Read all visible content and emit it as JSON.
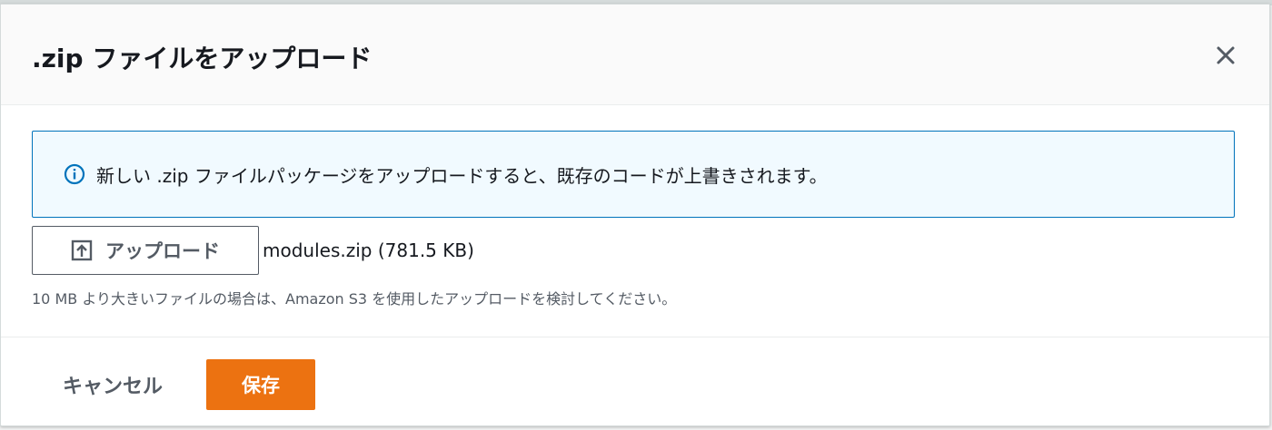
{
  "modal": {
    "title": ".zip ファイルをアップロード",
    "close_icon": "close-icon"
  },
  "alert": {
    "icon": "info-icon",
    "text": "新しい .zip ファイルパッケージをアップロードすると、既存のコードが上書きされます。",
    "accent_color": "#0073bb",
    "background_color": "#f1faff"
  },
  "upload": {
    "icon": "upload-icon",
    "button_label": "アップロード",
    "file_name": "modules.zip (781.5 KB)",
    "hint": "10 MB より大きいファイルの場合は、Amazon S3 を使用したアップロードを検討してください。"
  },
  "footer": {
    "cancel_label": "キャンセル",
    "save_label": "保存",
    "save_color": "#ec7211"
  }
}
